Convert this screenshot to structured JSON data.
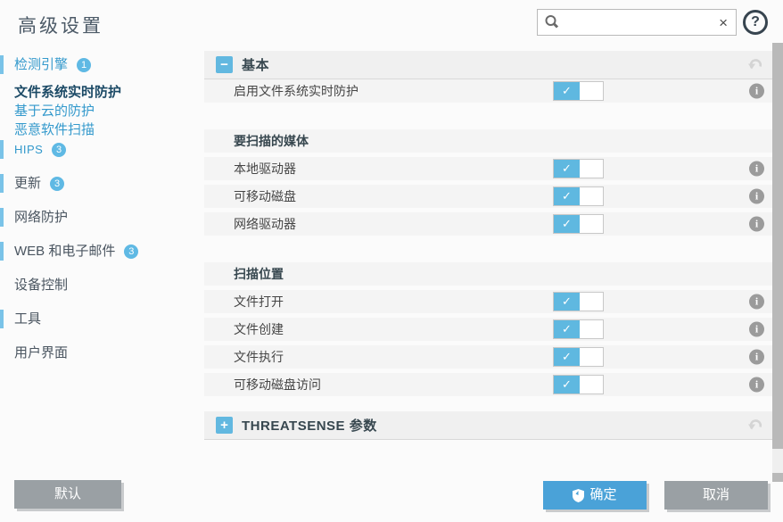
{
  "window": {
    "title": "高级设置"
  },
  "search": {
    "value": "",
    "placeholder": "",
    "clear_glyph": "×"
  },
  "icons": {
    "help_glyph": "?",
    "check_glyph": "✓",
    "collapse_glyph": "−",
    "expand_glyph": "+",
    "info_glyph": "i"
  },
  "colors": {
    "accent_blue": "#5fb8e0",
    "link_blue": "#3399cc",
    "selected_navy": "#1c4a66",
    "dark_slate": "#4a5560",
    "ok_button_blue": "#4aa2d8",
    "gray_button": "#9aa0a4",
    "badge_blue": "#5fb9e4"
  },
  "sidebar": {
    "items": [
      {
        "name": "detection-engine",
        "label": "检测引擎",
        "badge": "1",
        "style": "group-open",
        "bar": true
      },
      {
        "name": "real-time-file-protection",
        "label": "文件系统实时防护",
        "style": "selected",
        "bar": false
      },
      {
        "name": "cloud-based-protection",
        "label": "基于云的防护",
        "style": "link",
        "bar": false
      },
      {
        "name": "malware-scans",
        "label": "恶意软件扫描",
        "style": "link",
        "bar": false
      },
      {
        "name": "hips",
        "label": "HIPS",
        "badge": "3",
        "style": "link-small",
        "bar": true
      },
      {
        "name": "update",
        "label": "更新",
        "badge": "3",
        "style": "top",
        "bar": true
      },
      {
        "name": "network-protection",
        "label": "网络防护",
        "style": "top",
        "bar": true
      },
      {
        "name": "web-and-email",
        "label": "WEB 和电子邮件",
        "badge": "3",
        "style": "top",
        "bar": true
      },
      {
        "name": "device-control",
        "label": "设备控制",
        "style": "top",
        "bar": false
      },
      {
        "name": "tools",
        "label": "工具",
        "style": "top",
        "bar": true
      },
      {
        "name": "user-interface",
        "label": "用户界面",
        "style": "top",
        "bar": false
      }
    ]
  },
  "content": {
    "sections": [
      {
        "name": "basic",
        "title": "基本",
        "state": "expanded",
        "groups": [
          {
            "rows": [
              {
                "name": "enable-real-time-protection",
                "label": "启用文件系统实时防护",
                "toggle": true,
                "on": true,
                "info": true
              }
            ]
          },
          {
            "rows": [
              {
                "name": "media-to-scan",
                "label": "要扫描的媒体",
                "subheader": true
              },
              {
                "name": "local-drives",
                "label": "本地驱动器",
                "toggle": true,
                "on": true,
                "info": true
              },
              {
                "name": "removable-media",
                "label": "可移动磁盘",
                "toggle": true,
                "on": true,
                "info": true
              },
              {
                "name": "network-drives",
                "label": "网络驱动器",
                "toggle": true,
                "on": true,
                "info": true
              }
            ]
          },
          {
            "rows": [
              {
                "name": "scan-on",
                "label": "扫描位置",
                "subheader": true
              },
              {
                "name": "file-open",
                "label": "文件打开",
                "toggle": true,
                "on": true,
                "info": true
              },
              {
                "name": "file-creation",
                "label": "文件创建",
                "toggle": true,
                "on": true,
                "info": true
              },
              {
                "name": "file-execution",
                "label": "文件执行",
                "toggle": true,
                "on": true,
                "info": true
              },
              {
                "name": "removable-media-access",
                "label": "可移动磁盘访问",
                "toggle": true,
                "on": true,
                "info": true
              }
            ]
          }
        ]
      },
      {
        "name": "threatsense",
        "title": "THREATSENSE 参数",
        "state": "collapsed",
        "groups": []
      }
    ]
  },
  "footer": {
    "default_label": "默认",
    "ok_label": "确定",
    "cancel_label": "取消"
  }
}
